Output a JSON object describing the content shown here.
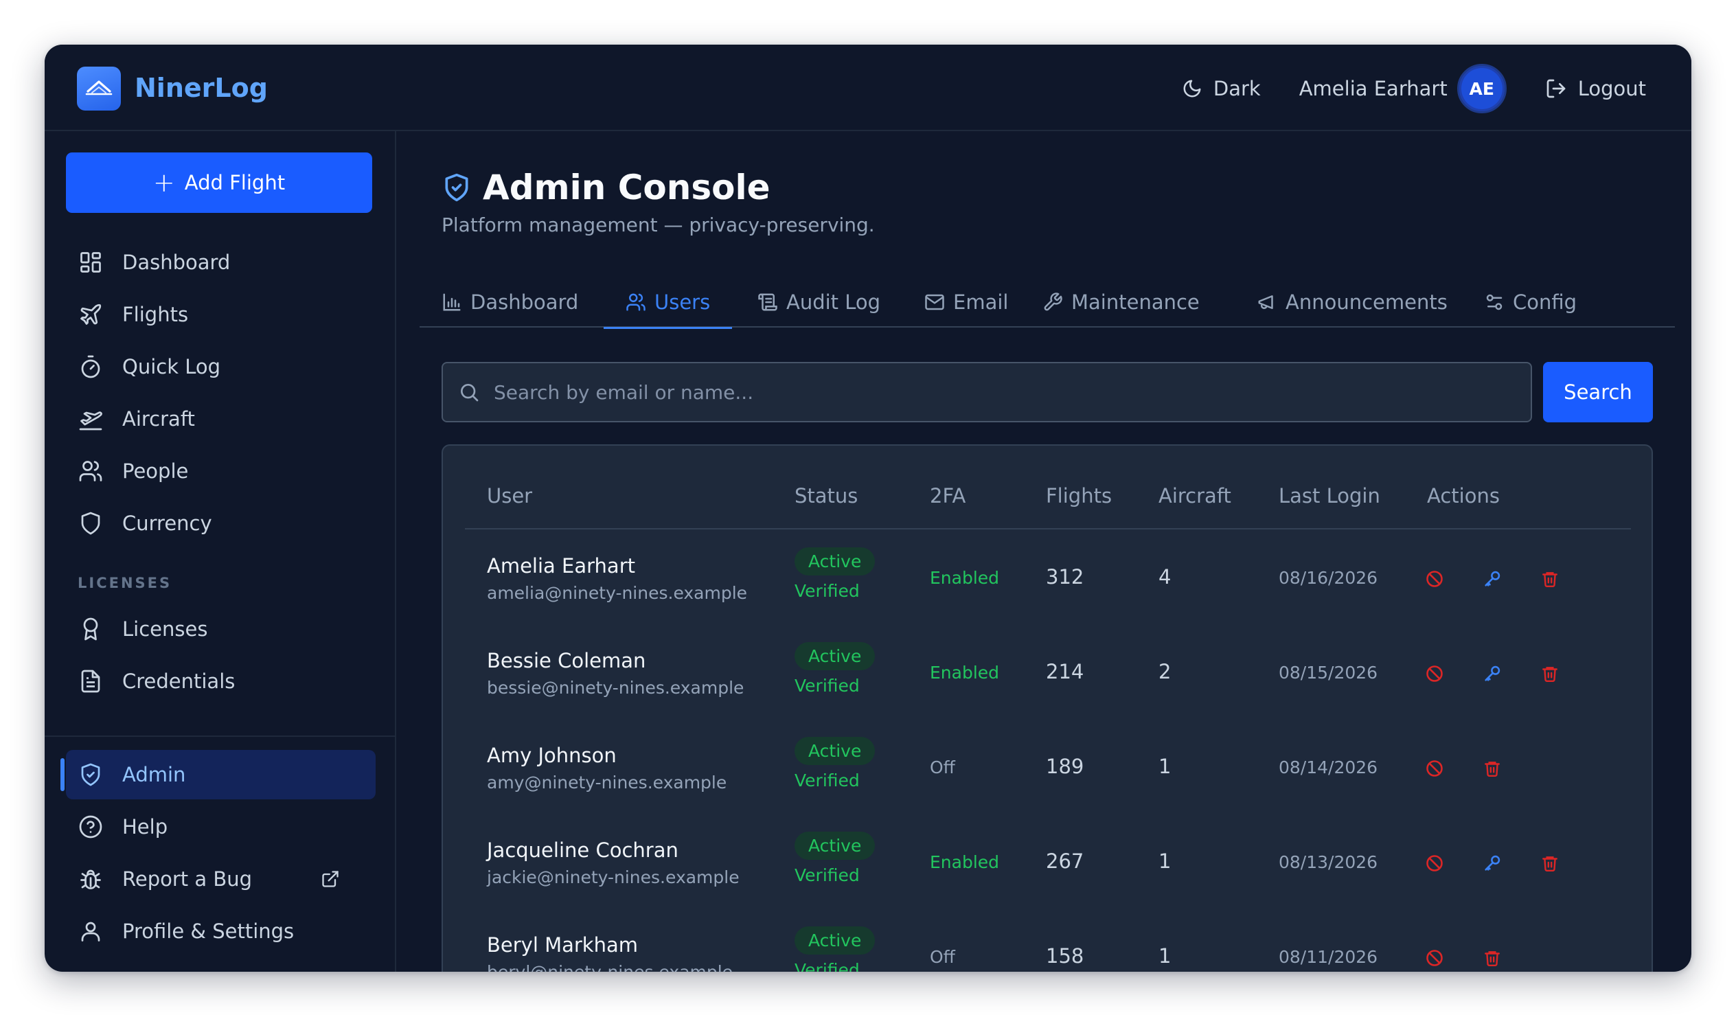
{
  "app": {
    "name": "NinerLog"
  },
  "topbar": {
    "theme_label": "Dark",
    "user_name": "Amelia Earhart",
    "avatar_initials": "AE",
    "logout_label": "Logout"
  },
  "sidebar": {
    "add_flight_label": "Add Flight",
    "items": [
      {
        "label": "Dashboard",
        "icon": "dashboard-grid-icon"
      },
      {
        "label": "Flights",
        "icon": "plane-icon"
      },
      {
        "label": "Quick Log",
        "icon": "stopwatch-icon"
      },
      {
        "label": "Aircraft",
        "icon": "plane-takeoff-icon"
      },
      {
        "label": "People",
        "icon": "users-icon"
      },
      {
        "label": "Currency",
        "icon": "shield-icon"
      }
    ],
    "section_label": "LICENSES",
    "license_items": [
      {
        "label": "Licenses",
        "icon": "award-icon"
      },
      {
        "label": "Credentials",
        "icon": "document-icon"
      }
    ],
    "bottom_items": [
      {
        "label": "Admin",
        "icon": "shield-check-icon",
        "active": true
      },
      {
        "label": "Help",
        "icon": "help-circle-icon"
      },
      {
        "label": "Report a Bug",
        "icon": "bug-icon"
      },
      {
        "label": "Profile & Settings",
        "icon": "user-icon"
      }
    ]
  },
  "page": {
    "title": "Admin Console",
    "subtitle": "Platform management — privacy-preserving."
  },
  "tabs": [
    {
      "label": "Dashboard",
      "icon": "bar-chart-icon"
    },
    {
      "label": "Users",
      "icon": "users-icon",
      "active": true
    },
    {
      "label": "Audit Log",
      "icon": "scroll-icon"
    },
    {
      "label": "Email",
      "icon": "mail-icon"
    },
    {
      "label": "Maintenance",
      "icon": "wrench-icon"
    },
    {
      "label": "Announcements",
      "icon": "megaphone-icon"
    },
    {
      "label": "Config",
      "icon": "settings-sliders-icon"
    }
  ],
  "search": {
    "placeholder": "Search by email or name...",
    "value": "",
    "button_label": "Search"
  },
  "table": {
    "headers": [
      "User",
      "Status",
      "2FA",
      "Flights",
      "Aircraft",
      "Last Login",
      "Actions"
    ],
    "rows": [
      {
        "name": "Amelia Earhart",
        "email": "amelia@ninety-nines.example",
        "status": "Active",
        "verified": "Verified",
        "twofa": "Enabled",
        "flights": "312",
        "aircraft": "4",
        "last_login": "08/16/2026"
      },
      {
        "name": "Bessie Coleman",
        "email": "bessie@ninety-nines.example",
        "status": "Active",
        "verified": "Verified",
        "twofa": "Enabled",
        "flights": "214",
        "aircraft": "2",
        "last_login": "08/15/2026"
      },
      {
        "name": "Amy Johnson",
        "email": "amy@ninety-nines.example",
        "status": "Active",
        "verified": "Verified",
        "twofa": "Off",
        "flights": "189",
        "aircraft": "1",
        "last_login": "08/14/2026"
      },
      {
        "name": "Jacqueline Cochran",
        "email": "jackie@ninety-nines.example",
        "status": "Active",
        "verified": "Verified",
        "twofa": "Enabled",
        "flights": "267",
        "aircraft": "1",
        "last_login": "08/13/2026"
      },
      {
        "name": "Beryl Markham",
        "email": "beryl@ninety-nines.example",
        "status": "Active",
        "verified": "Verified",
        "twofa": "Off",
        "flights": "158",
        "aircraft": "1",
        "last_login": "08/11/2026"
      }
    ]
  },
  "colors": {
    "accent": "#1a5cff",
    "background": "#0f172a",
    "card": "#1e293b",
    "success": "#22c55e",
    "danger": "#dc2626",
    "link": "#3b82f6"
  }
}
